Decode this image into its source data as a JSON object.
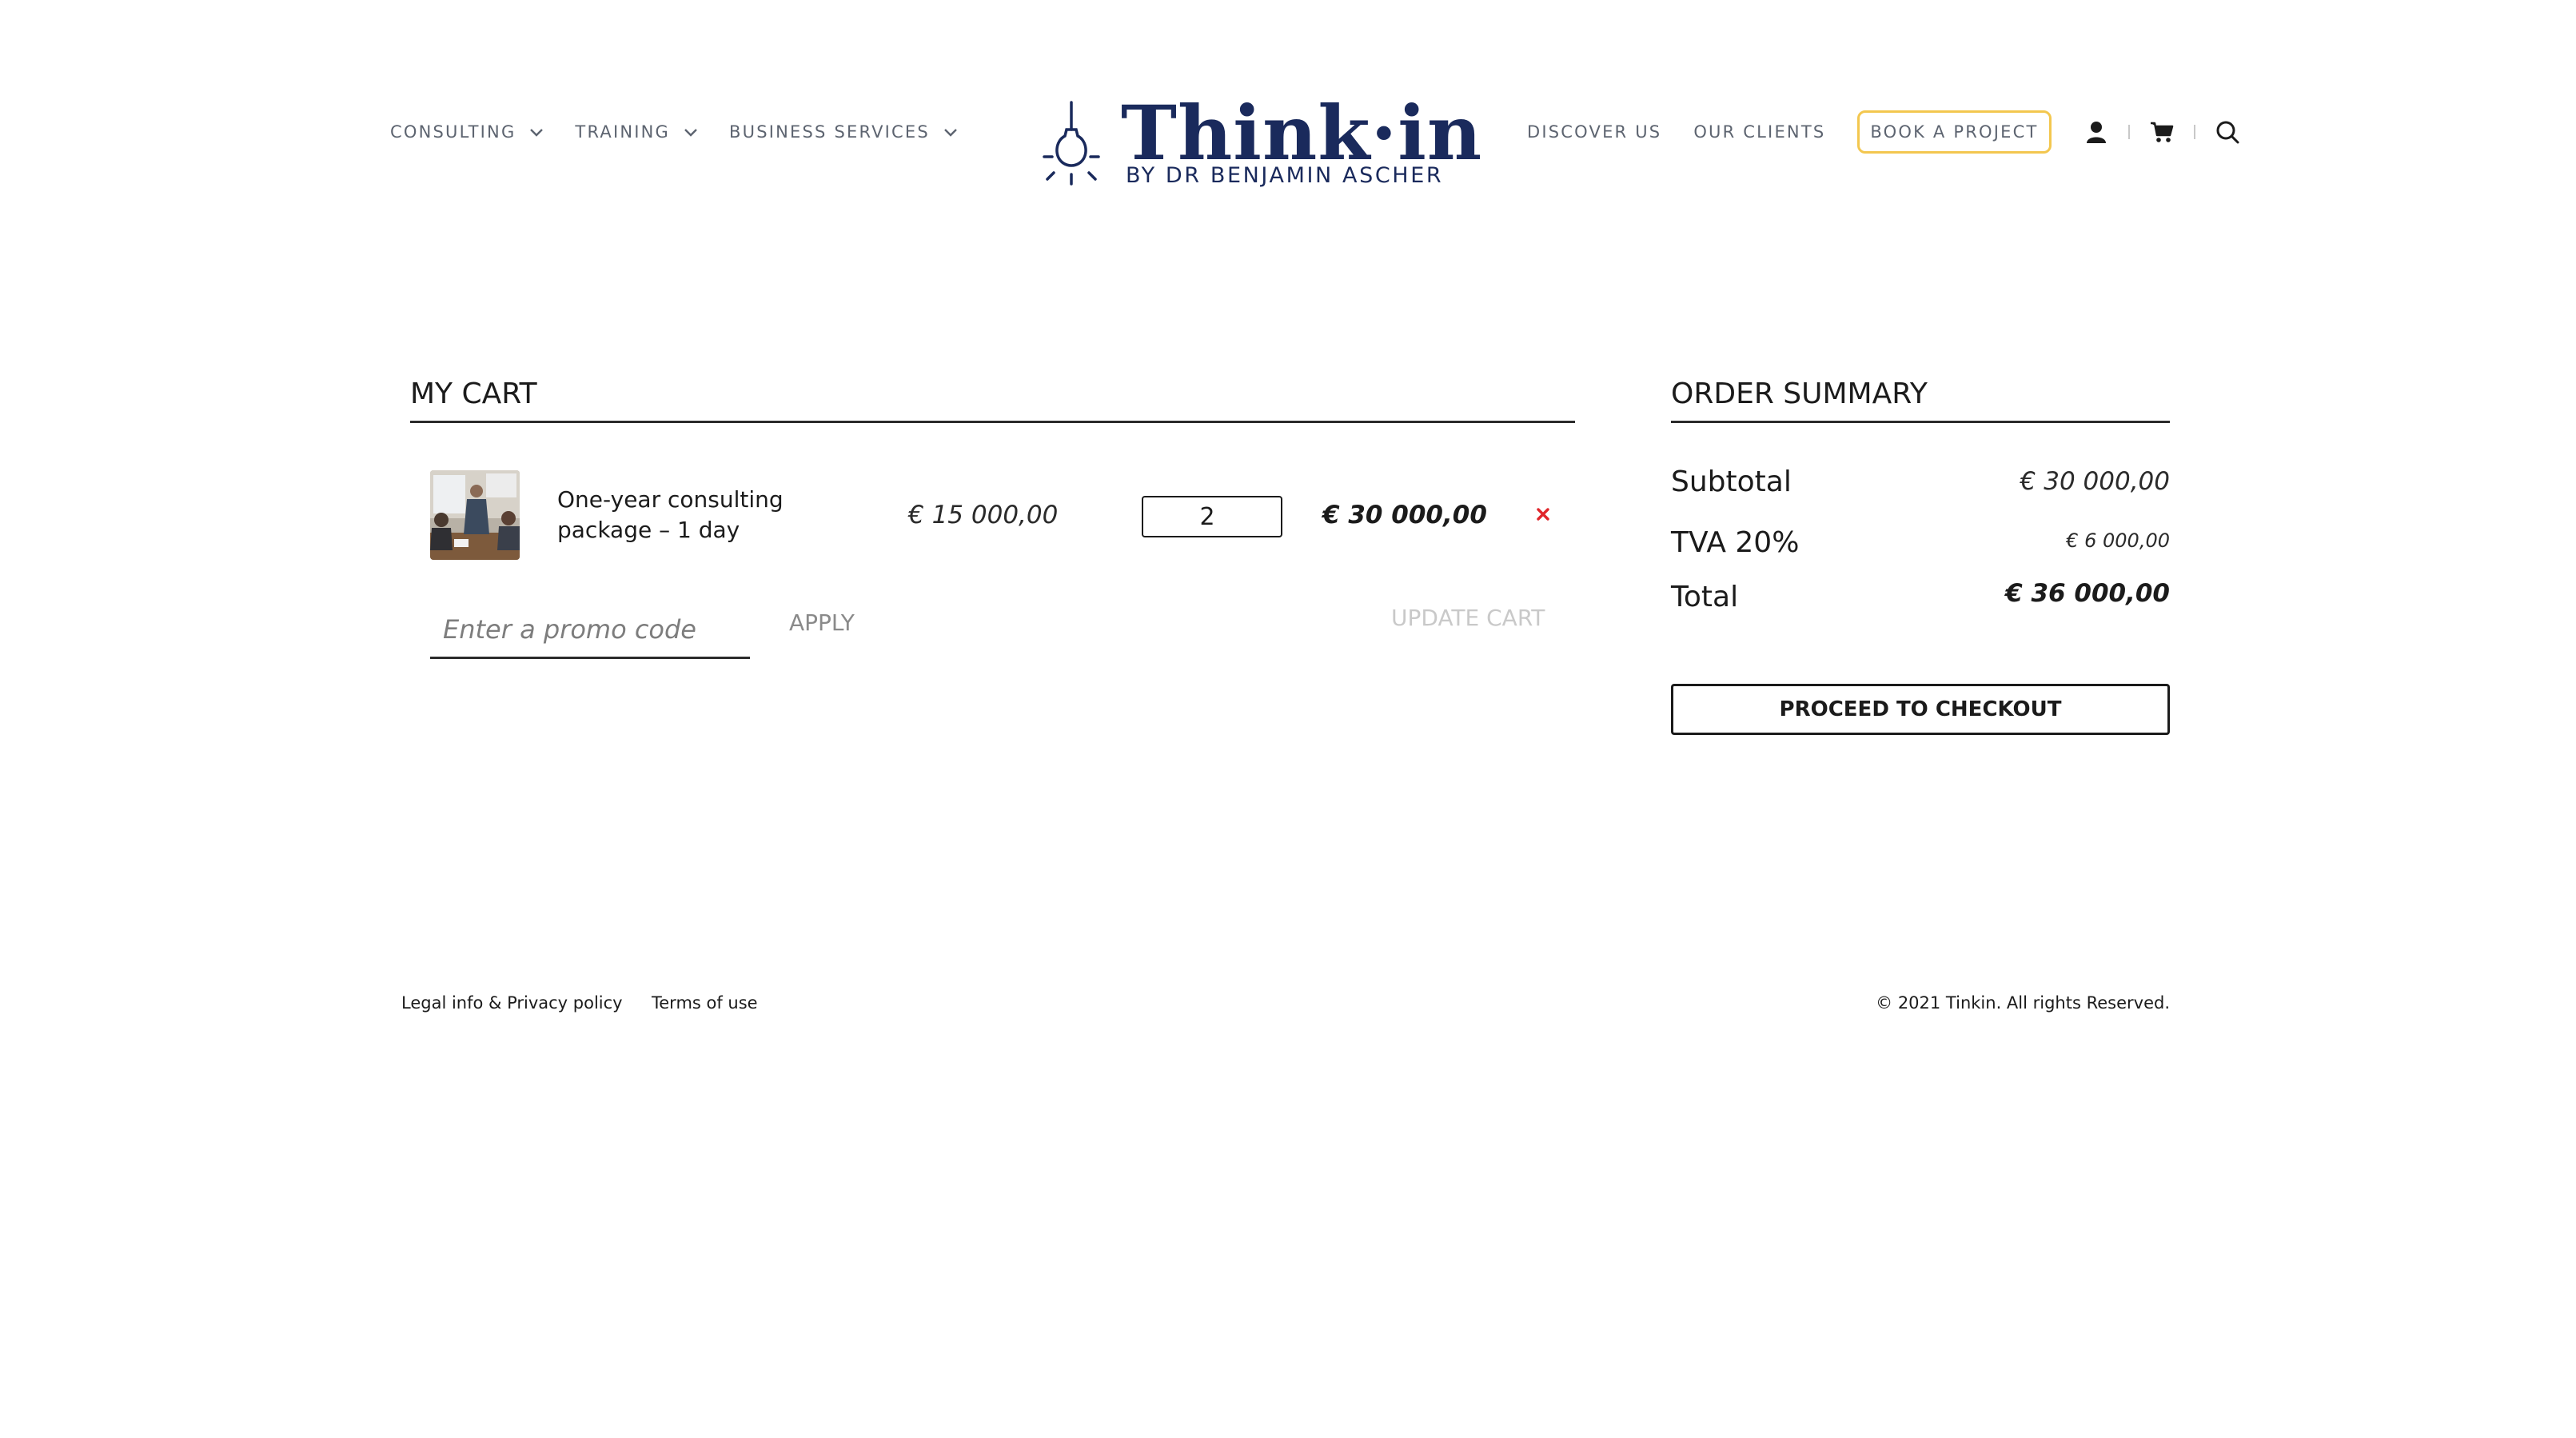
{
  "header": {
    "nav_left": [
      {
        "label": "CONSULTING",
        "icon": "chevron-down-icon"
      },
      {
        "label": "TRAINING",
        "icon": "chevron-down-icon"
      },
      {
        "label": "BUSINESS SERVICES",
        "icon": "chevron-down-icon"
      }
    ],
    "logo": {
      "title": "Think·in",
      "subtitle": "BY DR BENJAMIN ASCHER",
      "icon": "lightbulb-icon",
      "color": "#1a2a5c"
    },
    "nav_right": [
      {
        "label": "DISCOVER US"
      },
      {
        "label": "OUR CLIENTS"
      }
    ],
    "book_button": "BOOK A PROJECT",
    "book_button_border_color": "#f3c74f",
    "icons": [
      "user-icon",
      "cart-icon",
      "search-icon"
    ]
  },
  "cart": {
    "title": "MY CART",
    "items": [
      {
        "name": "One-year consulting package – 1 day",
        "unit_price": "€ 15 000,00",
        "quantity": "2",
        "line_total": "€ 30 000,00",
        "remove_icon": "close-icon",
        "remove_color": "#e0262b"
      }
    ],
    "promo_placeholder": "Enter a promo code",
    "apply_label": "APPLY",
    "update_label": "UPDATE CART"
  },
  "summary": {
    "title": "ORDER SUMMARY",
    "subtotal_label": "Subtotal",
    "subtotal_value": "€ 30 000,00",
    "tax_label": "TVA 20%",
    "tax_value": "€ 6 000,00",
    "total_label": "Total",
    "total_value": "€ 36 000,00",
    "checkout_label": "PROCEED TO CHECKOUT"
  },
  "footer": {
    "links": [
      "Legal info & Privacy policy",
      "Terms of use"
    ],
    "copyright": "© 2021 Tinkin. All rights Reserved."
  }
}
